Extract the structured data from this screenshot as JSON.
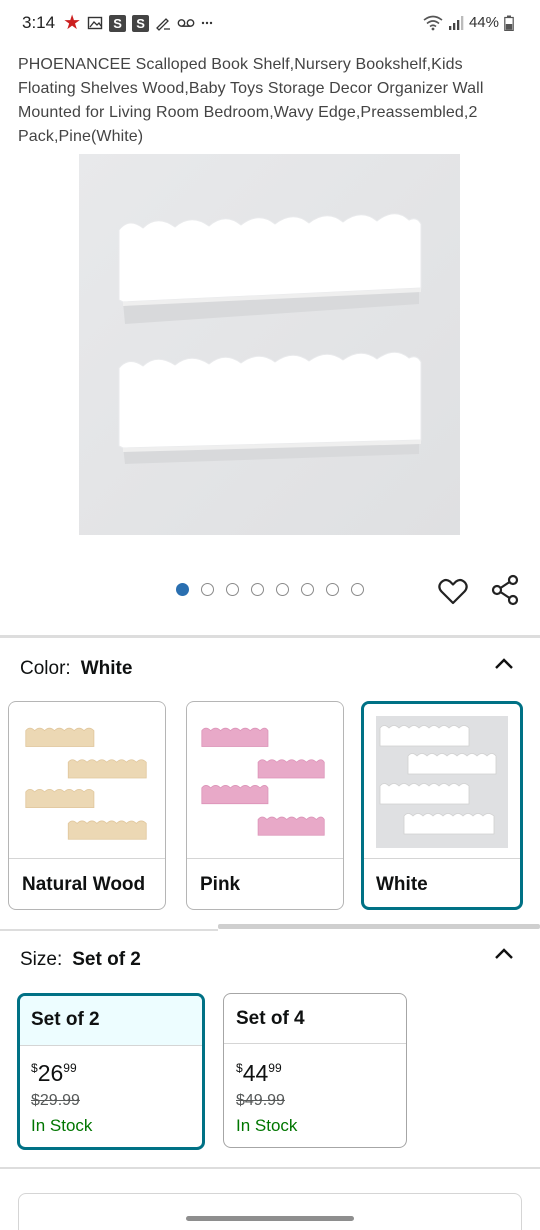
{
  "status_bar": {
    "time": "3:14",
    "battery": "44%",
    "icons": [
      "star-icon",
      "image-icon",
      "s-badge",
      "s-badge",
      "signature-icon",
      "voicemail-icon",
      "dots-icon",
      "wifi-icon",
      "signal-icon",
      "battery-icon"
    ],
    "s_badge_1": "S",
    "s_badge_2": "S",
    "star_color": "#cc1f1f"
  },
  "product": {
    "title": "PHOENANCEE Scalloped Book Shelf,Nursery Bookshelf,Kids Floating Shelves Wood,Baby Toys Storage Decor Organizer Wall Mounted for Living Room Bedroom,Wavy Edge,Preassembled,2 Pack,Pine(White)"
  },
  "gallery": {
    "image_count": 8,
    "active_index": 0,
    "active_dot_color": "#2a6fb0"
  },
  "color_section": {
    "label": "Color:",
    "selected_value": "White",
    "options": [
      {
        "label": "Natural Wood",
        "selected": false,
        "shelf_color": "#ecd8b4"
      },
      {
        "label": "Pink",
        "selected": false,
        "shelf_color": "#e8a9c8"
      },
      {
        "label": "White",
        "selected": true,
        "shelf_color": "#ffffff"
      }
    ]
  },
  "size_section": {
    "label": "Size:",
    "selected_value": "Set of 2",
    "options": [
      {
        "label": "Set of 2",
        "currency": "$",
        "price_whole": "26",
        "price_fraction": "99",
        "was_price": "$29.99",
        "stock": "In Stock",
        "selected": true
      },
      {
        "label": "Set of 4",
        "currency": "$",
        "price_whole": "44",
        "price_fraction": "99",
        "was_price": "$49.99",
        "stock": "In Stock",
        "selected": false
      }
    ]
  },
  "colors": {
    "accent": "#007185",
    "in_stock": "#007600",
    "selected_header_bg": "#edfdff"
  }
}
